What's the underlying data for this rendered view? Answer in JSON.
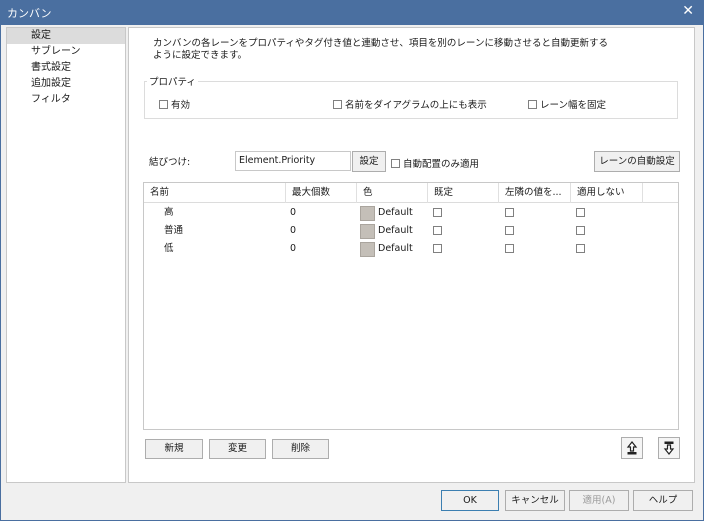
{
  "window": {
    "title": "カンバン"
  },
  "sidebar": {
    "items": [
      {
        "label": "設定"
      },
      {
        "label": "サブレーン"
      },
      {
        "label": "書式設定"
      },
      {
        "label": "追加設定"
      },
      {
        "label": "フィルタ"
      }
    ]
  },
  "main": {
    "description": "カンバンの各レーンをプロパティやタグ付き値と連動させ、項目を別のレーンに移動させると自動更新するように設定できます。",
    "properties": {
      "group_label": "プロパティ",
      "enabled_label": "有効",
      "show_name_label": "名前をダイアグラムの上にも表示",
      "fix_width_label": "レーン幅を固定"
    },
    "binding": {
      "label": "結びつけ:",
      "value": "Element.Priority",
      "settings_button": "設定",
      "auto_place_label": "自動配置のみ適用",
      "auto_lane_button": "レーンの自動設定"
    },
    "table": {
      "headers": [
        "名前",
        "最大個数",
        "色",
        "既定",
        "左隣の値を...",
        "適用しない"
      ],
      "rows": [
        {
          "name": "高",
          "max": "0",
          "color": "Default"
        },
        {
          "name": "普通",
          "max": "0",
          "color": "Default"
        },
        {
          "name": "低",
          "max": "0",
          "color": "Default"
        }
      ]
    },
    "actions": {
      "new": "新規",
      "modify": "変更",
      "delete": "削除"
    }
  },
  "dialog_buttons": {
    "ok": "OK",
    "cancel": "キャンセル",
    "apply": "適用(A)",
    "help": "ヘルプ"
  },
  "colors": {
    "titlebar": "#4a6fa0",
    "swatch": "#c4bfb8",
    "selection": "#dcdcdc"
  }
}
